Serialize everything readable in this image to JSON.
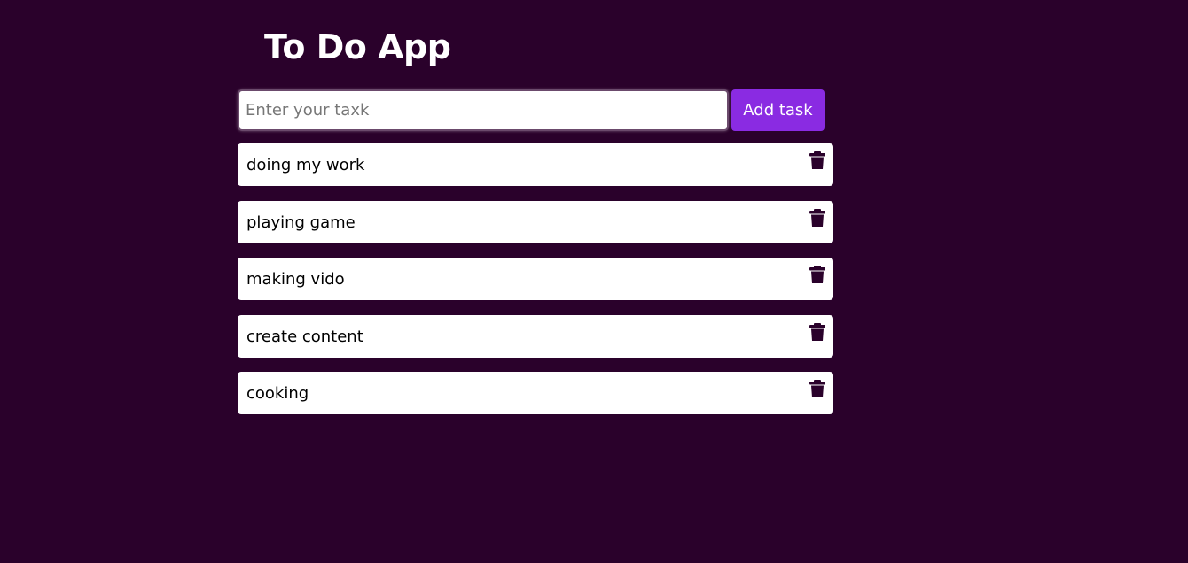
{
  "app": {
    "title": "To Do App"
  },
  "input": {
    "placeholder": "Enter your taxk",
    "value": ""
  },
  "add_button": {
    "label": "Add task",
    "color": "#8a2be2"
  },
  "colors": {
    "background": "#2a012b",
    "item_background": "#ffffff",
    "trash_icon": "#2a012b"
  },
  "tasks": [
    {
      "text": "doing my work",
      "icon": "trash-icon"
    },
    {
      "text": "playing game",
      "icon": "trash-icon"
    },
    {
      "text": "making vido",
      "icon": "trash-icon"
    },
    {
      "text": "create content",
      "icon": "trash-icon"
    },
    {
      "text": "cooking",
      "icon": "trash-icon"
    }
  ]
}
